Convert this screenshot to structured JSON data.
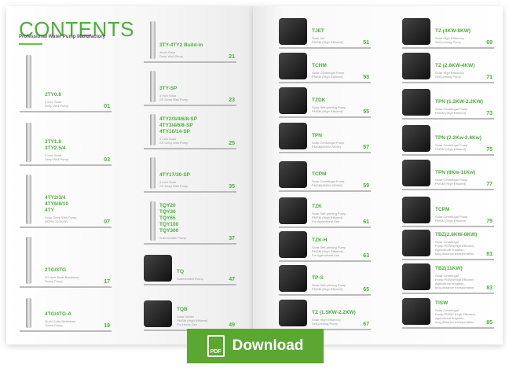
{
  "header": {
    "title": "CONTENTS",
    "subtitle": "Professional Water Pump Manufactory"
  },
  "accent_color": "#4caf3a",
  "download": {
    "label": "Download",
    "icon": "pdf-file-icon",
    "icon_text": "PDF",
    "color": "#5aa832"
  },
  "entries": [
    {
      "name": "2TY0.8",
      "desc": "2 Inch Solar\nDeep Well Pump",
      "page": "01"
    },
    {
      "name": "3TY1.8\n3TY2.5/4",
      "desc": "3 Inch Solar\nDeep Well Pump",
      "page": "03"
    },
    {
      "name": "4TY2/3/4\n4TY6/8/10\n4TY",
      "desc": "Solar Deep Well Pump\n(600W-11000W)",
      "page": "07"
    },
    {
      "name": "2TG/3TG",
      "desc": "2/3 Inch Solar Brushless\nScrew Pump",
      "page": "17"
    },
    {
      "name": "4TG/4TG-A",
      "desc": "4Inch Solar Brushless\nScrew Pump",
      "page": "19"
    },
    {
      "name": "3TY-4TY2 Build-in",
      "desc": "4Inch Solar\nDeep Well Pump",
      "page": "21"
    },
    {
      "name": "3TY-SP",
      "desc": "3 Inch Solar\nSS Deep Well Pump",
      "page": "23"
    },
    {
      "name": "4TY2/3/4/6/8-SP\n4TY3/4/6/8-SP\n4TY10/14-SP",
      "desc": "4 Inch Solar\nSS Deep Well Pump",
      "page": "25"
    },
    {
      "name": "4TY17/30-SP",
      "desc": "4 Inch Solar\nSS Deep Well Pump",
      "page": "35"
    },
    {
      "name": "TQY20\nTQY30\nTQY65\nTQY100\nTQY300",
      "desc": "Submersible Pump",
      "page": "37"
    },
    {
      "name": "TQ",
      "desc": "Submersible Pump",
      "page": "47"
    },
    {
      "name": "TQB",
      "desc": "Solar Vortex\nPMSM (High Efficient)\nFor Home Use",
      "page": "49"
    },
    {
      "name": "TJET",
      "desc": "Solar Jet\nPMSM (High Efficient)",
      "page": "51"
    },
    {
      "name": "TCHM",
      "desc": "Solar Centrifugal Pump\nPMSM (High Efficient)",
      "page": "53"
    },
    {
      "name": "TZDK",
      "desc": "Solar Self-priming Pump\nPMSM (High Efficient)",
      "page": "55"
    },
    {
      "name": "TPN",
      "desc": "Solar Centrifugal Pump\nPMSM(600W-750W)",
      "page": "57"
    },
    {
      "name": "TCPM",
      "desc": "Solar Centrifugal Pump\nPMSM(450W-1500W)",
      "page": "59"
    },
    {
      "name": "TZK",
      "desc": "Solar Self-priming Pump\nPMSM (High Efficient)\nFor Agricultural Use",
      "page": "61"
    },
    {
      "name": "TZK-H",
      "desc": "Solar Self-priming Pump\nPMSM (High Efficient)\nFor Agricultural Use",
      "page": "63"
    },
    {
      "name": "TP-S",
      "desc": "Solar Self-priming Pump\nPMSM (High Efficient)",
      "page": "65"
    },
    {
      "name": "TZ (1.5KW-2.2KW)",
      "desc": "Solar High Efficiency\nSelf-priming Pump",
      "page": "67"
    },
    {
      "name": "TZ (4KW-8KW)",
      "desc": "Solar High Efficiency\nSelf-priming Pump",
      "page": "69"
    },
    {
      "name": "TZ (2.8KW-4KW)",
      "desc": "Solar High Efficiency\nSelf-priming Pump",
      "page": "71"
    },
    {
      "name": "TPN (1.2KW-2.2KW)",
      "desc": "Solar Centrifugal Pump\nPMSM (High Efficient)",
      "page": "73"
    },
    {
      "name": "TPN (2.2Kw-2.8Kw)",
      "desc": "Solar Centrifugal Pump\nPMSM (High Efficient)",
      "page": "75"
    },
    {
      "name": "TPN (8Kw-11Kw)",
      "desc": "Solar Centrifugal Pump\nPMSM (High Efficient)",
      "page": "77"
    },
    {
      "name": "TCPM",
      "desc": "Solar Centrifugal Pump\nPMSM (High Efficient)",
      "page": "79"
    },
    {
      "name": "TBZ(2.8KW-8KW)",
      "desc": "Solar Centrifugal\nPump PMSM(High Efficient)\nAgricultural irrigation,\nlong-distance transportation",
      "page": "81"
    },
    {
      "name": "TBZ(11KW)",
      "desc": "Solar Centrifugal\nPump PMSM(High Efficient)\nAgricultural irrigation,\nlong-distance transportation",
      "page": "83"
    },
    {
      "name": "TISW",
      "desc": "Solar Centrifugal\nPump PMSM (High Efficient)\nAgricultural irrigation,\nlong-distance transportation",
      "page": "85"
    }
  ]
}
